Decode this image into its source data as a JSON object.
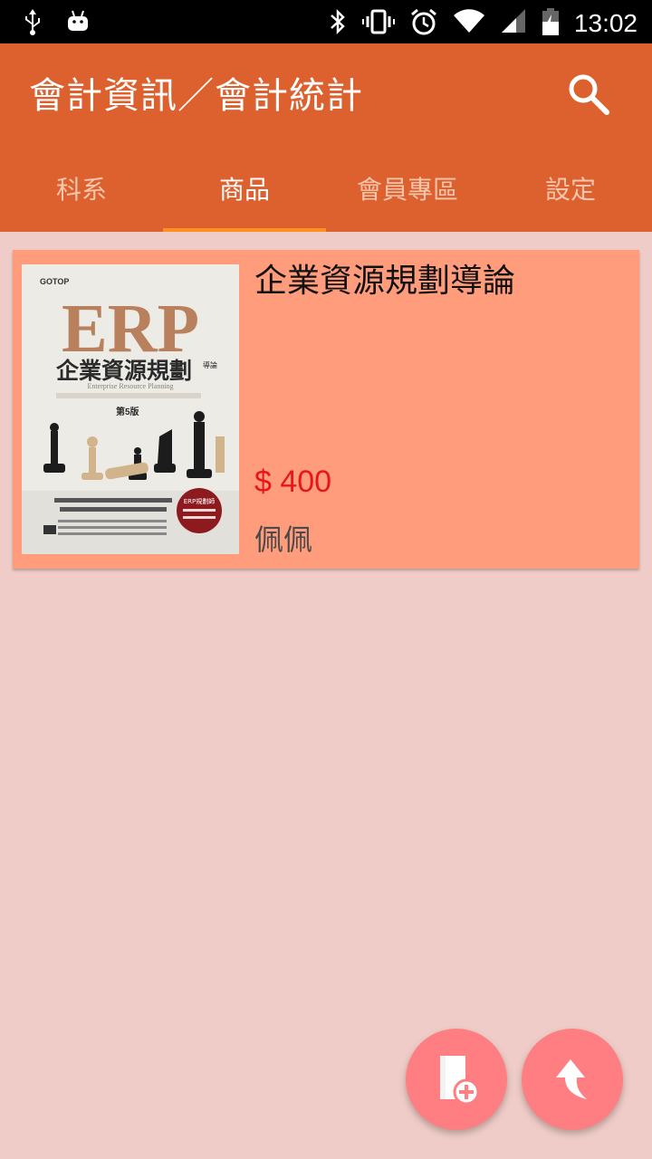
{
  "status_bar": {
    "time": "13:02",
    "icons": [
      "usb-icon",
      "android-debug-icon",
      "bluetooth-icon",
      "vibrate-icon",
      "alarm-icon",
      "wifi-icon",
      "signal-icon",
      "battery-charging-icon"
    ]
  },
  "app_bar": {
    "title": "會計資訊／會計統計",
    "search_icon": "search-icon"
  },
  "tabs": [
    {
      "label": "科系",
      "active": false
    },
    {
      "label": "商品",
      "active": true
    },
    {
      "label": "會員專區",
      "active": false
    },
    {
      "label": "設定",
      "active": false
    }
  ],
  "products": [
    {
      "name": "企業資源規劃導論",
      "price": "$ 400",
      "seller": "佩佩",
      "cover": {
        "publisher": "GOTOP",
        "big_title": "ERP",
        "title": "企業資源規劃",
        "title_suffix": "導論",
        "subtitle": "Enterprise Resource Planning",
        "edition": "第5版",
        "badge": "ERP規劃師"
      }
    }
  ],
  "fabs": {
    "add_icon": "add-document-icon",
    "back_icon": "back-arrow-icon"
  },
  "colors": {
    "app_bar": "#dc612f",
    "tab_indicator": "#ff8f1f",
    "background": "#f0ccc8",
    "card": "#ff9c7c",
    "price": "#e8161b",
    "fab": "#ff7e82"
  }
}
